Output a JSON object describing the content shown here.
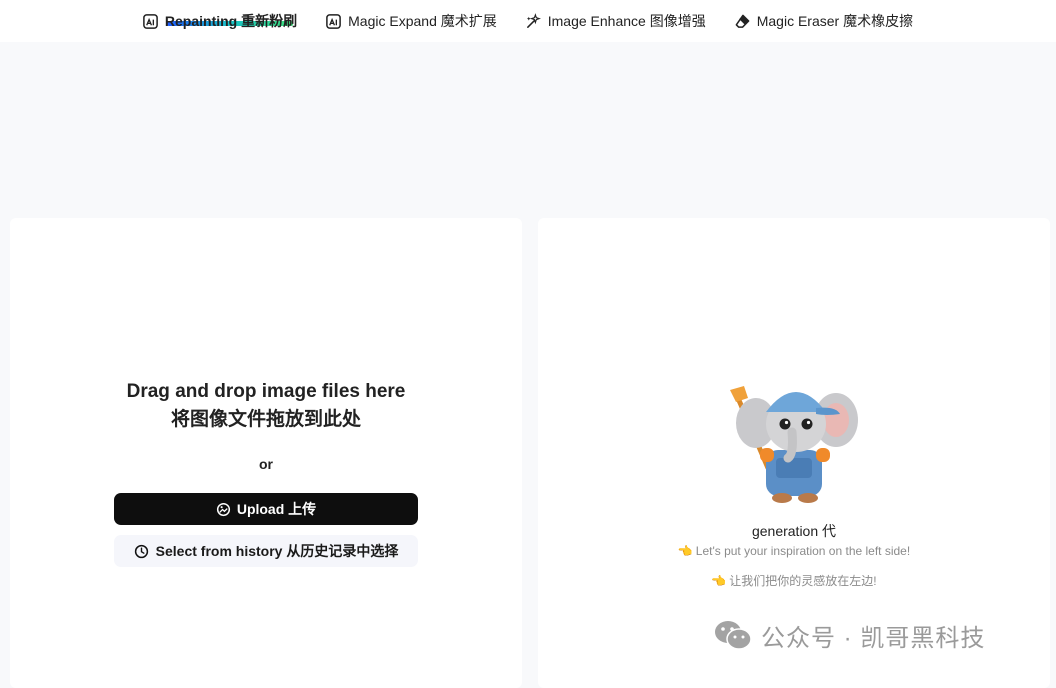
{
  "nav": {
    "tabs": [
      {
        "label": "Repainting 重新粉刷",
        "icon": "repaint-icon",
        "active": true
      },
      {
        "label": "Magic Expand 魔术扩展",
        "icon": "expand-icon",
        "active": false
      },
      {
        "label": "Image Enhance 图像增强",
        "icon": "sparkle-icon",
        "active": false
      },
      {
        "label": "Magic Eraser 魔术橡皮擦",
        "icon": "eraser-icon",
        "active": false
      }
    ]
  },
  "upload_panel": {
    "title_en": "Drag and drop image files here",
    "title_zh": "将图像文件拖放到此处",
    "or": "or",
    "upload_label": "Upload 上传",
    "history_label": "Select from history 从历史记录中选择"
  },
  "result_panel": {
    "generation_label": "generation 代",
    "hint_en": "Let's put your inspiration on the left side!",
    "hint_zh": "让我们把你的灵感放在左边!",
    "hint_icon": "pointing-hand-icon",
    "mascot": "elephant-painter-mascot"
  },
  "watermark": {
    "text": "公众号 · 凯哥黑科技",
    "icon": "wechat-icon"
  },
  "colors": {
    "accent_gradient": [
      "#1e5bff",
      "#19c3c8",
      "#3fe07a"
    ],
    "primary_button": "#0e0e0e",
    "secondary_button": "#f5f6fb",
    "page_bg": "#f8f9fb"
  }
}
